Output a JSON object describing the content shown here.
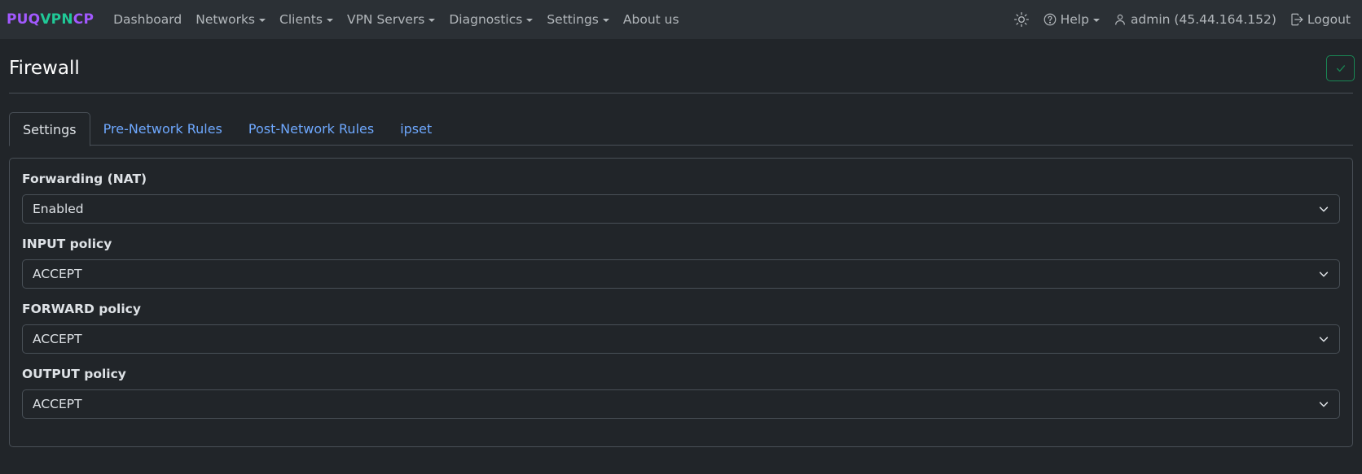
{
  "navbar": {
    "brand": {
      "part1": "PUQ",
      "part2": "VPN",
      "part3": "CP"
    },
    "links": [
      {
        "label": "Dashboard",
        "dropdown": false
      },
      {
        "label": "Networks",
        "dropdown": true
      },
      {
        "label": "Clients",
        "dropdown": true
      },
      {
        "label": "VPN Servers",
        "dropdown": true
      },
      {
        "label": "Diagnostics",
        "dropdown": true
      },
      {
        "label": "Settings",
        "dropdown": true
      },
      {
        "label": "About us",
        "dropdown": false
      }
    ],
    "right": {
      "theme_icon": "sun-icon",
      "help_label": "Help",
      "user_label": "admin (45.44.164.152)",
      "logout_label": "Logout"
    }
  },
  "page": {
    "title": "Firewall",
    "save_icon": "check-icon"
  },
  "tabs": [
    {
      "label": "Settings",
      "active": true
    },
    {
      "label": "Pre-Network Rules",
      "active": false
    },
    {
      "label": "Post-Network Rules",
      "active": false
    },
    {
      "label": "ipset",
      "active": false
    }
  ],
  "form": {
    "fields": [
      {
        "label": "Forwarding (NAT)",
        "value": "Enabled"
      },
      {
        "label": "INPUT policy",
        "value": "ACCEPT"
      },
      {
        "label": "FORWARD policy",
        "value": "ACCEPT"
      },
      {
        "label": "OUTPUT policy",
        "value": "ACCEPT"
      }
    ]
  },
  "colors": {
    "brand_purple": "#a259ff",
    "brand_green": "#20c997",
    "link_blue": "#6ea8fe",
    "success_green": "#198754",
    "background": "#212529",
    "navbar_bg": "#2b3035"
  }
}
